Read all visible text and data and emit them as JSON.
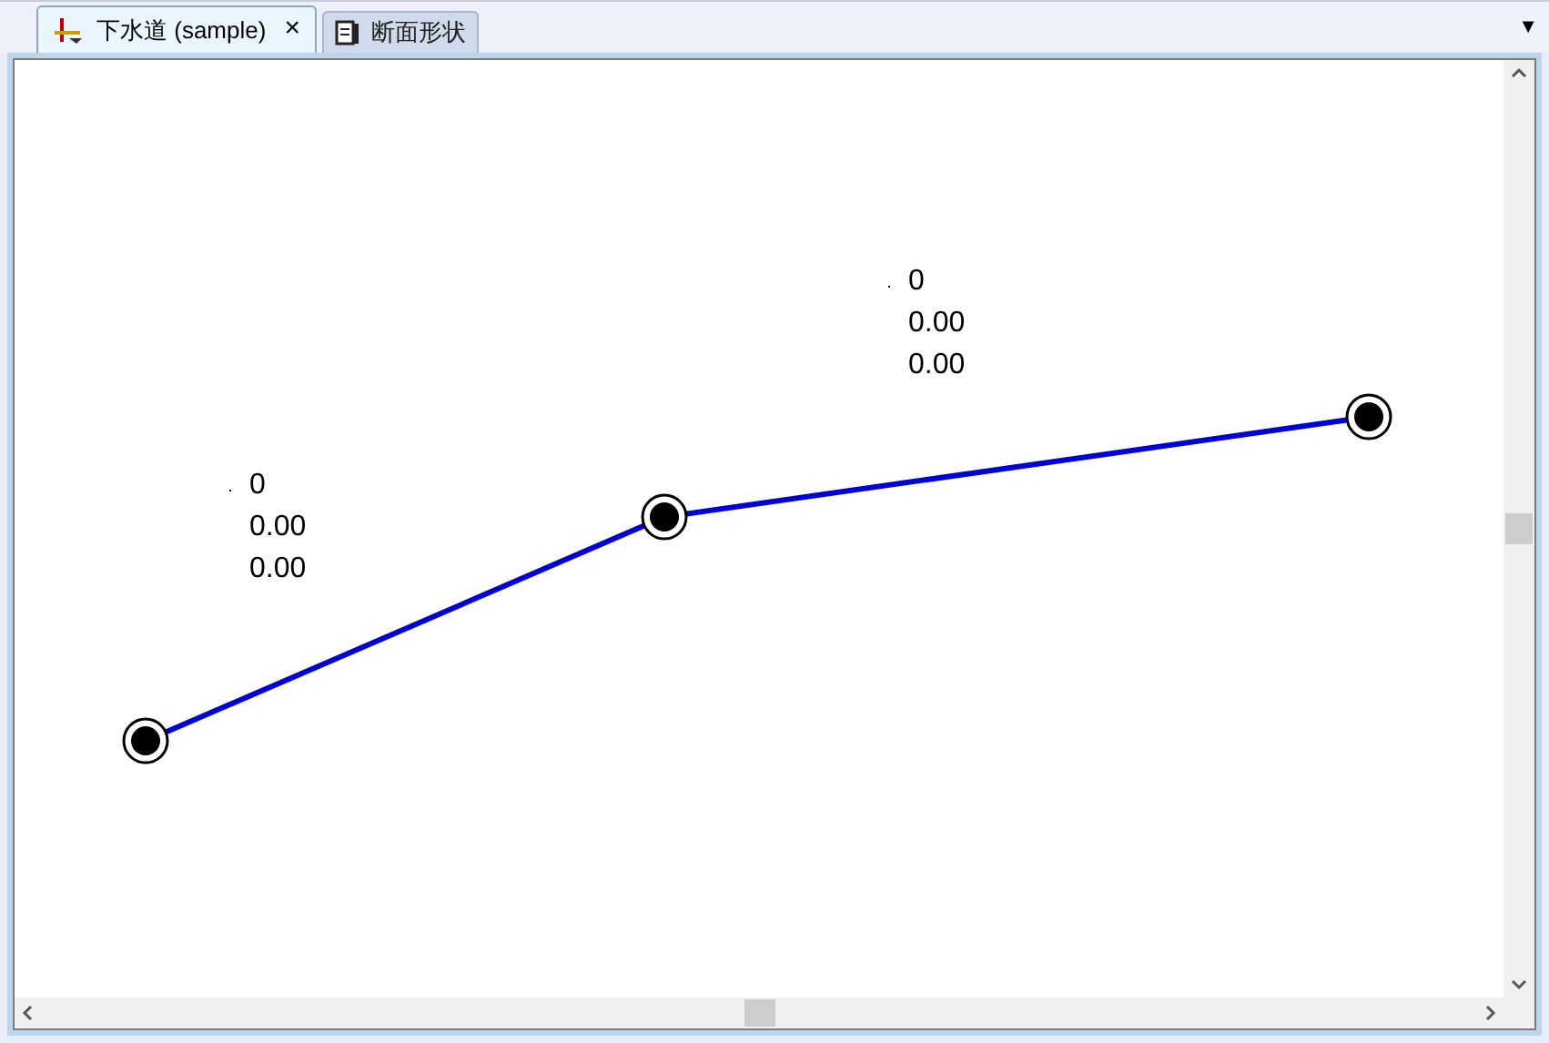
{
  "tabs": [
    {
      "label": "下水道 (sample)",
      "selected": true,
      "close": "×"
    },
    {
      "label": "断面形状",
      "selected": false
    }
  ],
  "tab_menu": "▼",
  "canvas": {
    "nodes": [
      {
        "kind": "node"
      },
      {
        "kind": "node"
      },
      {
        "kind": "node"
      }
    ],
    "labels": [
      {
        "lines": [
          "0",
          "0.00",
          "0.00"
        ]
      },
      {
        "lines": [
          "0",
          "0.00",
          "0.00"
        ]
      }
    ]
  }
}
